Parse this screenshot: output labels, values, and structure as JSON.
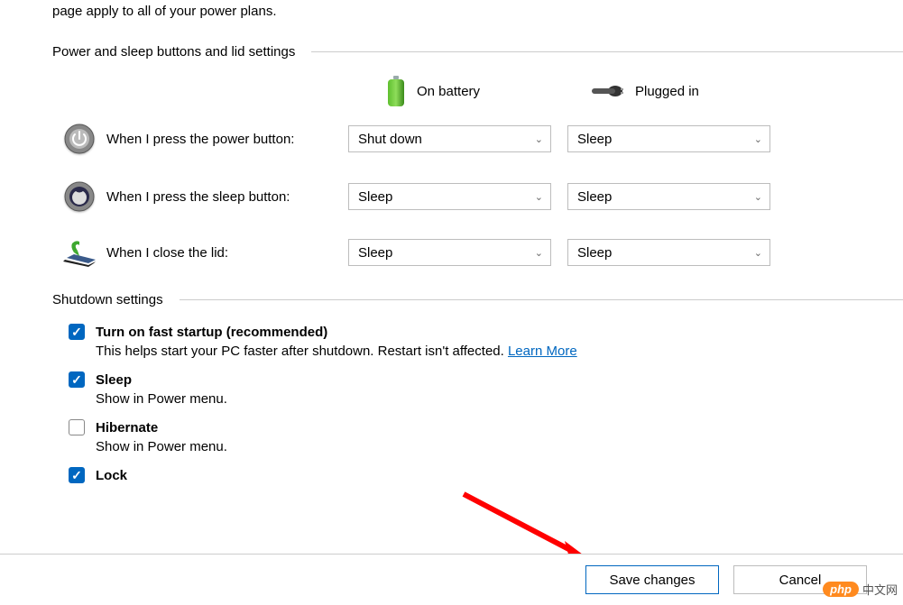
{
  "intro": "page apply to all of your power plans.",
  "sections": {
    "buttons_lid": {
      "title": "Power and sleep buttons and lid settings",
      "columns": {
        "battery": "On battery",
        "plugged": "Plugged in"
      },
      "rows": [
        {
          "label": "When I press the power button:",
          "battery": "Shut down",
          "plugged": "Sleep"
        },
        {
          "label": "When I press the sleep button:",
          "battery": "Sleep",
          "plugged": "Sleep"
        },
        {
          "label": "When I close the lid:",
          "battery": "Sleep",
          "plugged": "Sleep"
        }
      ]
    },
    "shutdown": {
      "title": "Shutdown settings",
      "items": [
        {
          "title": "Turn on fast startup (recommended)",
          "desc": "This helps start your PC faster after shutdown. Restart isn't affected. ",
          "checked": true,
          "link": "Learn More"
        },
        {
          "title": "Sleep",
          "desc": "Show in Power menu.",
          "checked": true
        },
        {
          "title": "Hibernate",
          "desc": "Show in Power menu.",
          "checked": false
        },
        {
          "title": "Lock",
          "checked": true
        }
      ]
    }
  },
  "footer": {
    "save": "Save changes",
    "cancel": "Cancel"
  },
  "watermark": "中文网"
}
